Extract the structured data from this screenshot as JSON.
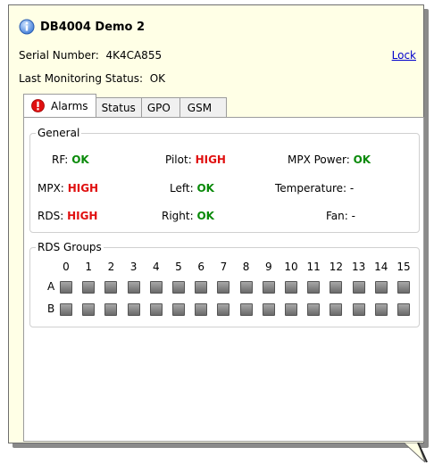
{
  "title": "DB4004 Demo 2",
  "serial_label": "Serial Number:",
  "serial_value": "4K4CA855",
  "lock_label": "Lock",
  "monitor_label": "Last Monitoring Status:",
  "monitor_value": "OK",
  "tabs": [
    {
      "label": "Alarms",
      "active": true,
      "icon": "warning-icon"
    },
    {
      "label": "Status",
      "active": false
    },
    {
      "label": "GPO",
      "active": false
    },
    {
      "label": "GSM",
      "active": false
    }
  ],
  "general": {
    "legend": "General",
    "rf": {
      "label": "RF:",
      "value": "OK"
    },
    "mpx": {
      "label": "MPX:",
      "value": "HIGH"
    },
    "rds": {
      "label": "RDS:",
      "value": "HIGH"
    },
    "pilot": {
      "label": "Pilot:",
      "value": "HIGH"
    },
    "left": {
      "label": "Left:",
      "value": "OK"
    },
    "right": {
      "label": "Right:",
      "value": "OK"
    },
    "mpx_power": {
      "label": "MPX Power:",
      "value": "OK"
    },
    "temperature": {
      "label": "Temperature:",
      "value": "-"
    },
    "fan": {
      "label": "Fan:",
      "value": "-"
    }
  },
  "rds_groups": {
    "legend": "RDS Groups",
    "columns": [
      "0",
      "1",
      "2",
      "3",
      "4",
      "5",
      "6",
      "7",
      "8",
      "9",
      "10",
      "11",
      "12",
      "13",
      "14",
      "15"
    ],
    "rows": [
      "A",
      "B"
    ]
  },
  "colors": {
    "ok": "#0a8a0a",
    "high": "#e01010",
    "tooltip_bg": "#ffffe6",
    "link": "#0000cc"
  }
}
